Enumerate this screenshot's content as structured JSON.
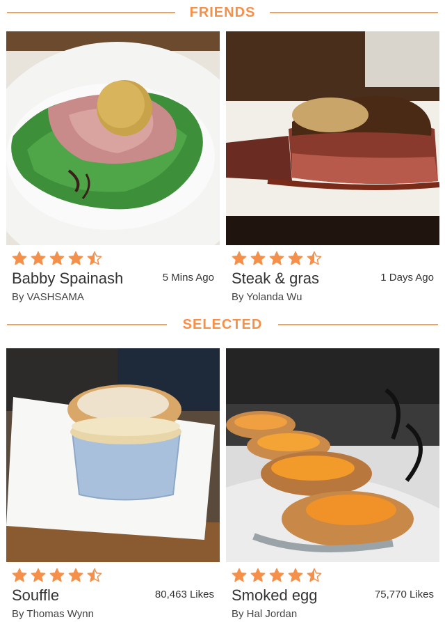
{
  "sections": [
    {
      "title": "FRIENDS",
      "cards": [
        {
          "name": "Babby Spainash",
          "author": "By VASHSAMA",
          "meta": "5 Mins Ago",
          "rating": 4.5
        },
        {
          "name": "Steak & gras",
          "author": "By Yolanda Wu",
          "meta": "1 Days Ago",
          "rating": 4.5
        }
      ]
    },
    {
      "title": "SELECTED",
      "cards": [
        {
          "name": "Souffle",
          "author": "By Thomas Wynn",
          "meta": "80,463 Likes",
          "rating": 4.5
        },
        {
          "name": "Smoked egg",
          "author": "By Hal Jordan",
          "meta": "75,770 Likes",
          "rating": 4.5
        }
      ]
    }
  ],
  "colors": {
    "accent": "#f5904a",
    "star": "#f5904a"
  }
}
